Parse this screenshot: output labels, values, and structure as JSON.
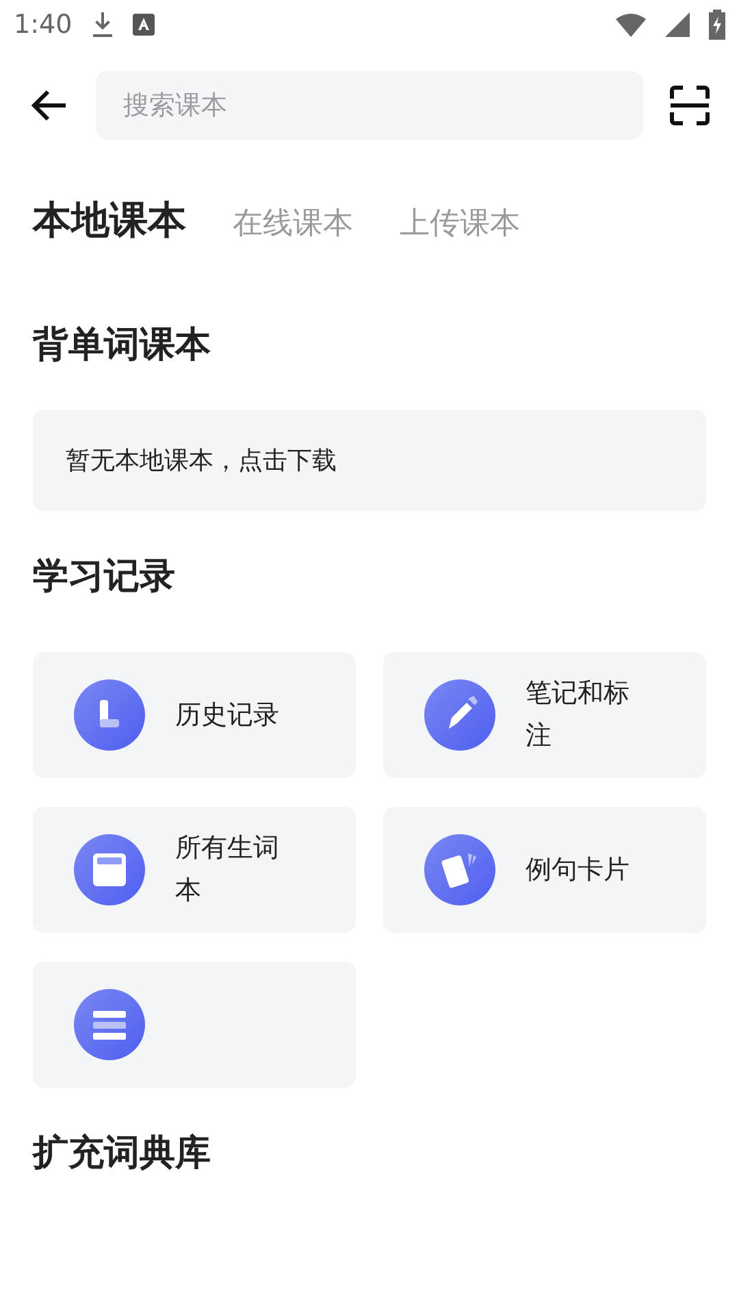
{
  "status_bar": {
    "time": "1:40"
  },
  "search": {
    "placeholder": "搜索课本"
  },
  "tabs": [
    {
      "label": "本地课本",
      "selected": true
    },
    {
      "label": "在线课本",
      "selected": false
    },
    {
      "label": "上传课本",
      "selected": false
    }
  ],
  "sections": [
    {
      "title": "背单词课本",
      "empty_text": "暂无本地课本，点击下载"
    },
    {
      "title": "学习记录",
      "cards": [
        {
          "kind": "history",
          "label": "历史记录"
        },
        {
          "kind": "notes",
          "label": "笔记和标注"
        },
        {
          "kind": "wordbook",
          "label": "所有生词本"
        },
        {
          "kind": "cards",
          "label": "例句卡片"
        },
        {
          "kind": "list"
        }
      ]
    },
    {
      "title": "扩充词典库"
    }
  ]
}
